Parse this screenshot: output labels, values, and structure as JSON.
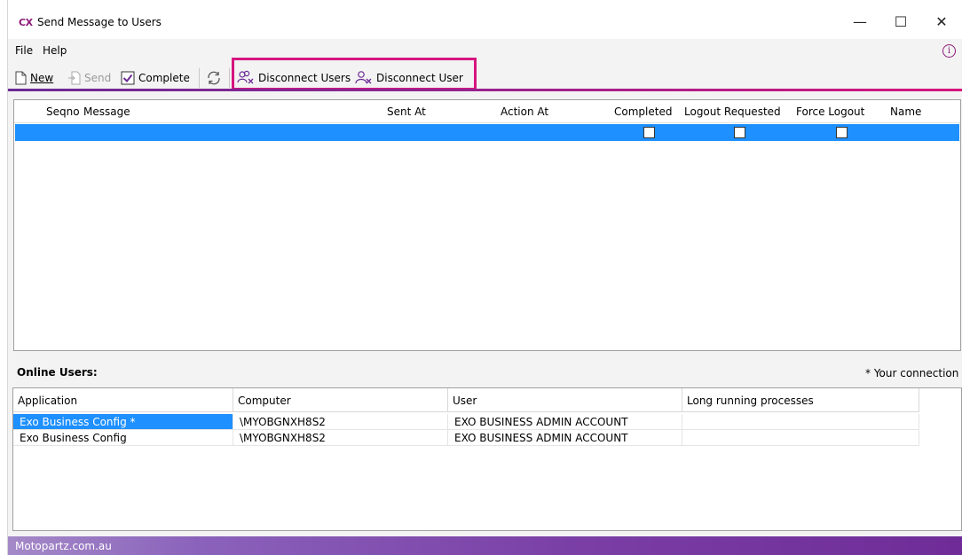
{
  "window": {
    "logo": "CX",
    "title": "Send Message to Users",
    "minimize": "—",
    "maximize": "☐",
    "close": "✕"
  },
  "menu": {
    "file": "File",
    "help": "Help",
    "info": "i"
  },
  "toolbar": {
    "new_label": "New",
    "send_label": "Send",
    "complete_label": "Complete",
    "disconnect_users_label": "Disconnect Users",
    "disconnect_user_label": "Disconnect User"
  },
  "messages": {
    "columns": [
      "Seqno",
      "Message",
      "Sent At",
      "Action At",
      "Completed",
      "Logout Requested",
      "Force Logout",
      "Name"
    ]
  },
  "online": {
    "label": "Online Users:",
    "your_connection": "* Your connection",
    "columns": [
      "Application",
      "Computer",
      "User",
      "Long running processes"
    ],
    "rows": [
      [
        "Exo Business Config *",
        "\\MYOBGNXH8S2",
        "EXO BUSINESS ADMIN ACCOUNT",
        ""
      ],
      [
        "Exo Business Config",
        "\\MYOBGNXH8S2",
        "EXO BUSINESS ADMIN ACCOUNT",
        ""
      ]
    ]
  },
  "footer": {
    "company": "Motopartz.com.au"
  },
  "colors": {
    "accent": "#d6157f",
    "selection": "#1e90ff",
    "brand_purple": "#6f2c98"
  }
}
